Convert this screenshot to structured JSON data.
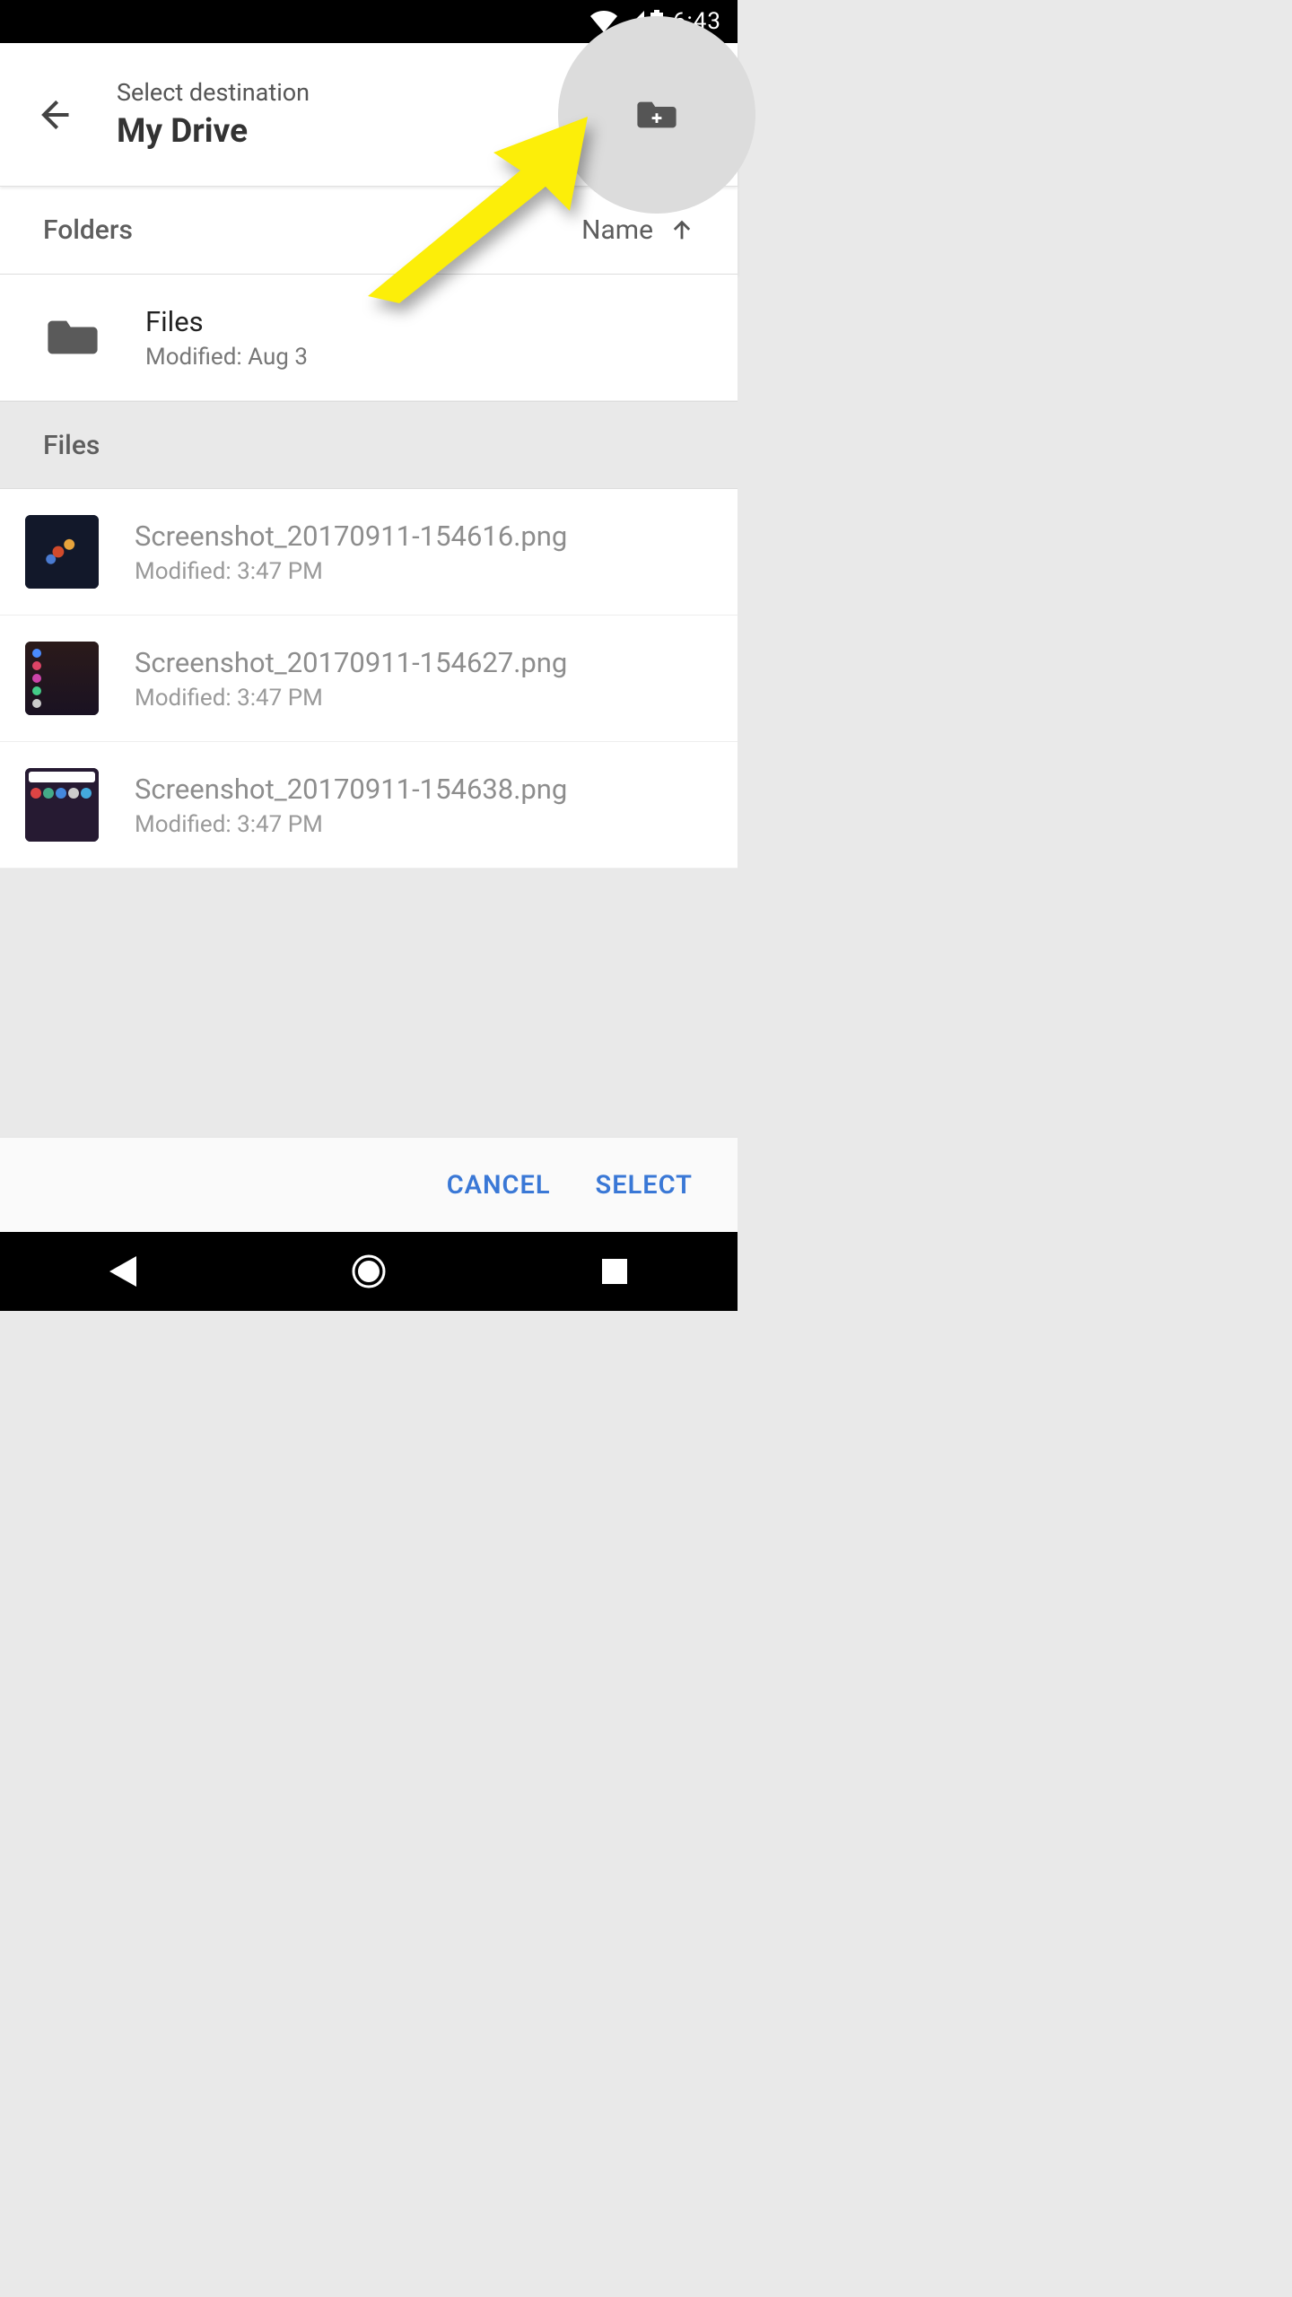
{
  "status": {
    "time": "6:43"
  },
  "header": {
    "subtitle": "Select destination",
    "title": "My Drive"
  },
  "sort": {
    "section_label": "Folders",
    "sort_by": "Name"
  },
  "folders": [
    {
      "name": "Files",
      "modified": "Modified: Aug 3"
    }
  ],
  "files_section_label": "Files",
  "files": [
    {
      "name": "Screenshot_20170911-154616.png",
      "modified": "Modified: 3:47 PM",
      "thumb": "turtle"
    },
    {
      "name": "Screenshot_20170911-154627.png",
      "modified": "Modified: 3:47 PM",
      "thumb": "appgrid"
    },
    {
      "name": "Screenshot_20170911-154638.png",
      "modified": "Modified: 3:47 PM",
      "thumb": "homescreen"
    }
  ],
  "actions": {
    "cancel": "CANCEL",
    "select": "SELECT"
  }
}
